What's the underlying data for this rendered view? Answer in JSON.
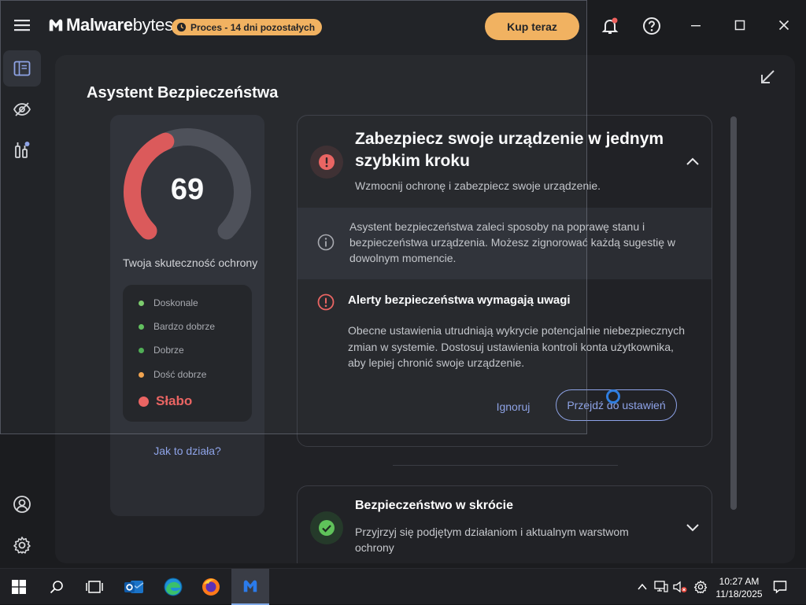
{
  "app": {
    "logo_bold": "Malware",
    "logo_light": "bytes",
    "trial_badge": "Proces - 14 dni pozostałych",
    "buy_button": "Kup teraz"
  },
  "page": {
    "title": "Asystent Bezpieczeństwa"
  },
  "score": {
    "value": "69",
    "value_fraction": 0.69,
    "caption": "Twoja skuteczność ochrony",
    "levels": [
      {
        "label": "Doskonale",
        "color": "#7ccf6a"
      },
      {
        "label": "Bardzo dobrze",
        "color": "#5fc25a"
      },
      {
        "label": "Dobrze",
        "color": "#4caf50"
      },
      {
        "label": "Dość dobrze",
        "color": "#f7a44a"
      }
    ],
    "current_level": {
      "label": "Słabo",
      "color": "#f0615e"
    },
    "how_link": "Jak to działa?"
  },
  "main_card": {
    "title": "Zabezpiecz swoje urządzenie w jednym szybkim kroku",
    "subtitle": "Wzmocnij ochronę i zabezpiecz swoje urządzenie.",
    "info": "Asystent bezpieczeństwa zaleci sposoby na poprawę stanu i bezpieczeństwa urządzenia. Możesz zignorować każdą sugestię w dowolnym momencie.",
    "alert_title": "Alerty bezpieczeństwa wymagają uwagi",
    "alert_text": "Obecne ustawienia utrudniają wykrycie potencjalnie niebezpiecznych zmian w systemie. Dostosuj ustawienia kontroli konta użytkownika, aby lepiej chronić swoje urządzenie.",
    "ignore_button": "Ignoruj",
    "settings_button": "Przejdź do ustawień"
  },
  "summary_card": {
    "title": "Bezpieczeństwo w skrócie",
    "text": "Przyjrzyj się podjętym działaniom i aktualnym warstwom ochrony"
  },
  "taskbar": {
    "time": "10:27 AM",
    "date": "11/18/2025"
  },
  "colors": {
    "accent": "#f7b35c",
    "link": "#8ea3e8",
    "danger": "#f0615e",
    "success": "#5fc25a"
  }
}
